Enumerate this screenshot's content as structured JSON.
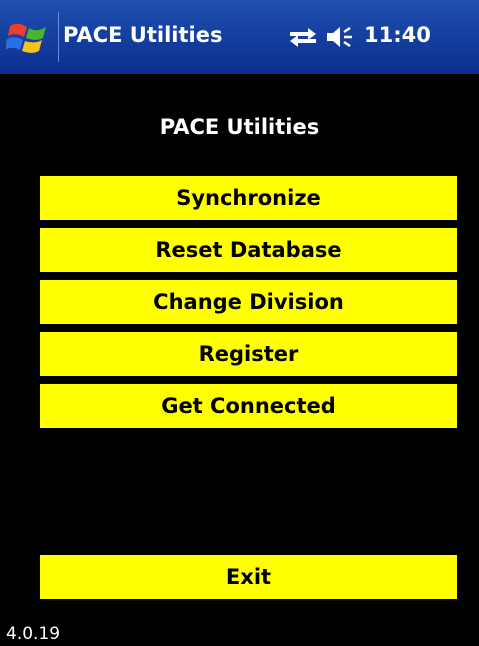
{
  "titlebar": {
    "title": "PACE Utilities",
    "time": "11:40",
    "background_color": "#0a2f8f",
    "icons": {
      "start": "windows-flag-icon",
      "connectivity": "connectivity-arrows-icon",
      "volume": "speaker-volume-icon"
    }
  },
  "main": {
    "heading": "PACE Utilities",
    "button_color": "#ffff00",
    "buttons": [
      {
        "label": "Synchronize"
      },
      {
        "label": "Reset Database"
      },
      {
        "label": "Change Division"
      },
      {
        "label": "Register"
      },
      {
        "label": "Get Connected"
      }
    ],
    "exit_label": "Exit"
  },
  "footer": {
    "version": "4.0.19"
  }
}
